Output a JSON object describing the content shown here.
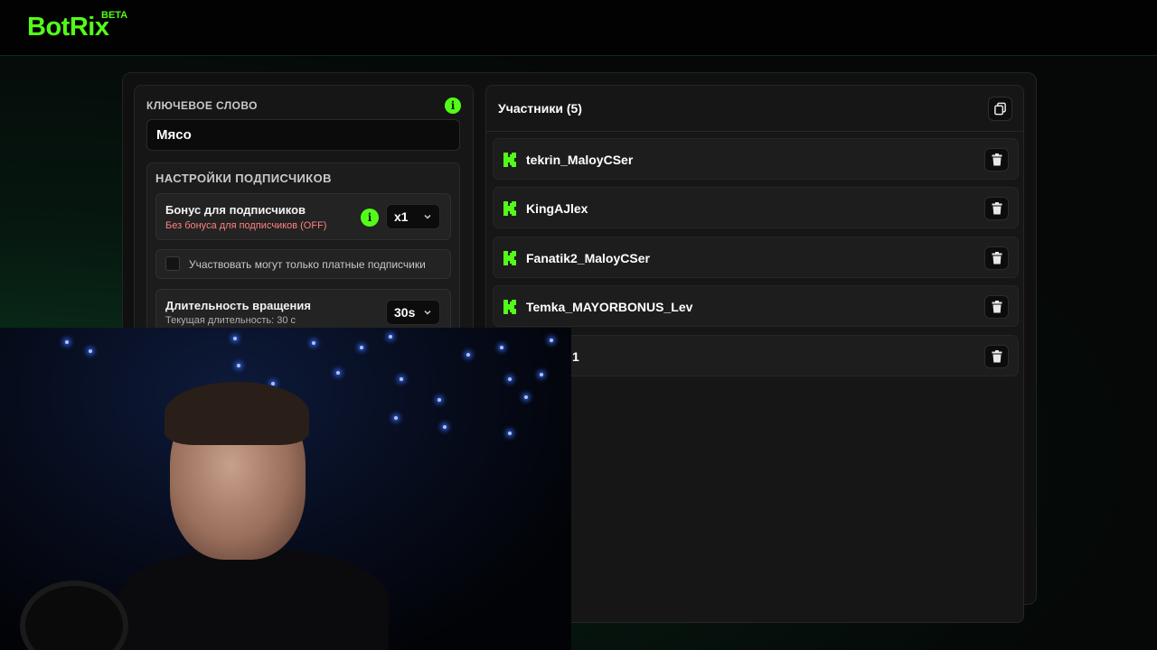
{
  "app": {
    "logo": "BotRix",
    "badge": "BETA"
  },
  "colors": {
    "accent": "#53fc18",
    "bonus_off": "#ff8080",
    "background": "#050807"
  },
  "keyword": {
    "label": "КЛЮЧЕВОЕ СЛОВО",
    "info_icon": "info-icon",
    "value": "Мясо"
  },
  "subscriber_settings": {
    "title": "НАСТРОЙКИ ПОДПИСЧИКОВ",
    "bonus": {
      "label": "Бонус для подписчиков",
      "status": "Без бонуса для подписчиков (OFF)",
      "selected": "x1"
    },
    "paid_only": {
      "label": "Участвовать могут только платные подписчики",
      "checked": false
    },
    "spin_duration": {
      "label": "Длительность вращения",
      "current": "Текущая длительность: 30 с",
      "selected": "30s"
    }
  },
  "participants": {
    "title": "Участники (5)",
    "items": [
      {
        "name": "tekrin_MaloyCSer"
      },
      {
        "name": "KingAJlex"
      },
      {
        "name": "Fanatik2_MaloyCSer"
      },
      {
        "name": "Temka_MAYORBONUS_Lev"
      },
      {
        "name": "1"
      }
    ]
  }
}
